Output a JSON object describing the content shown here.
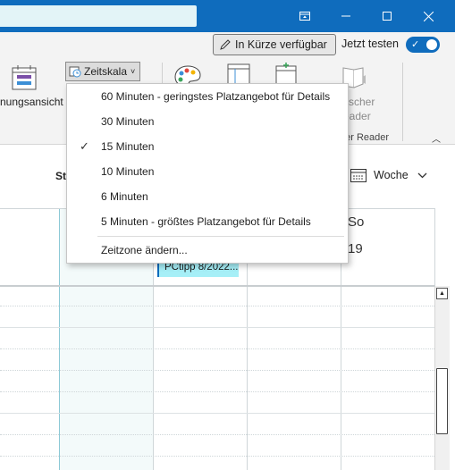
{
  "colors": {
    "titlebar": "#0f6cbd",
    "search_bg": "#e3f4f7",
    "event_bg": "#a6eff7",
    "toggle_on": "#0f6cbd"
  },
  "titlebar": {
    "icons": [
      "restore-ribbon-icon",
      "minimize-icon",
      "maximize-icon",
      "close-icon"
    ]
  },
  "topbar": {
    "coming_soon_label": "In Kürze verfügbar",
    "try_now_label": "Jetzt testen",
    "toggle_on": true
  },
  "ribbon": {
    "view_label_partial": "nungsansicht",
    "timescale_label": "Zeitskala",
    "reader_label_line1": "tischer",
    "reader_label_line2": "eader",
    "reader_group_label": "her Reader"
  },
  "timescale_menu": {
    "items": [
      {
        "label": "60 Minuten - geringstes Platzangebot für Details",
        "checked": false
      },
      {
        "label": "30 Minuten",
        "checked": false
      },
      {
        "label": "15 Minuten",
        "checked": true
      },
      {
        "label": "10 Minuten",
        "checked": false
      },
      {
        "label": "6 Minuten",
        "checked": false
      },
      {
        "label": "5 Minuten - größtes Platzangebot für Details",
        "checked": false
      }
    ],
    "change_timezone": "Zeitzone ändern...",
    "check_glyph": "✓"
  },
  "calendar": {
    "st_label": "St",
    "view_mode": "Woche",
    "day_label": "So",
    "day_number": "19",
    "event_title": "PCtipp 8/2022..."
  }
}
